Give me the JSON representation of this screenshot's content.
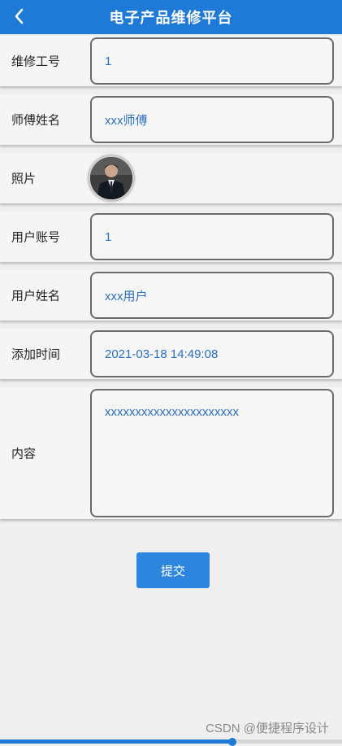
{
  "header": {
    "title": "电子产品维修平台",
    "back_icon": "chevron-left-icon"
  },
  "form": {
    "fields": [
      {
        "label": "维修工号",
        "value": "1"
      },
      {
        "label": "师傅姓名",
        "value": "xxx师傅"
      },
      {
        "label": "照片",
        "avatar": "photo-avatar"
      },
      {
        "label": "用户账号",
        "value": "1"
      },
      {
        "label": "用户姓名",
        "value": "xxx用户"
      },
      {
        "label": "添加时间",
        "value": "2021-03-18 14:49:08"
      },
      {
        "label": "内容",
        "value": "xxxxxxxxxxxxxxxxxxxxxx"
      }
    ],
    "submit_label": "提交"
  },
  "footer": {
    "watermark": "CSDN @便捷程序设计"
  },
  "progress": {
    "value": 0.68
  },
  "colors": {
    "primary": "#1e7ad6",
    "value_text": "#2b6fbf"
  }
}
